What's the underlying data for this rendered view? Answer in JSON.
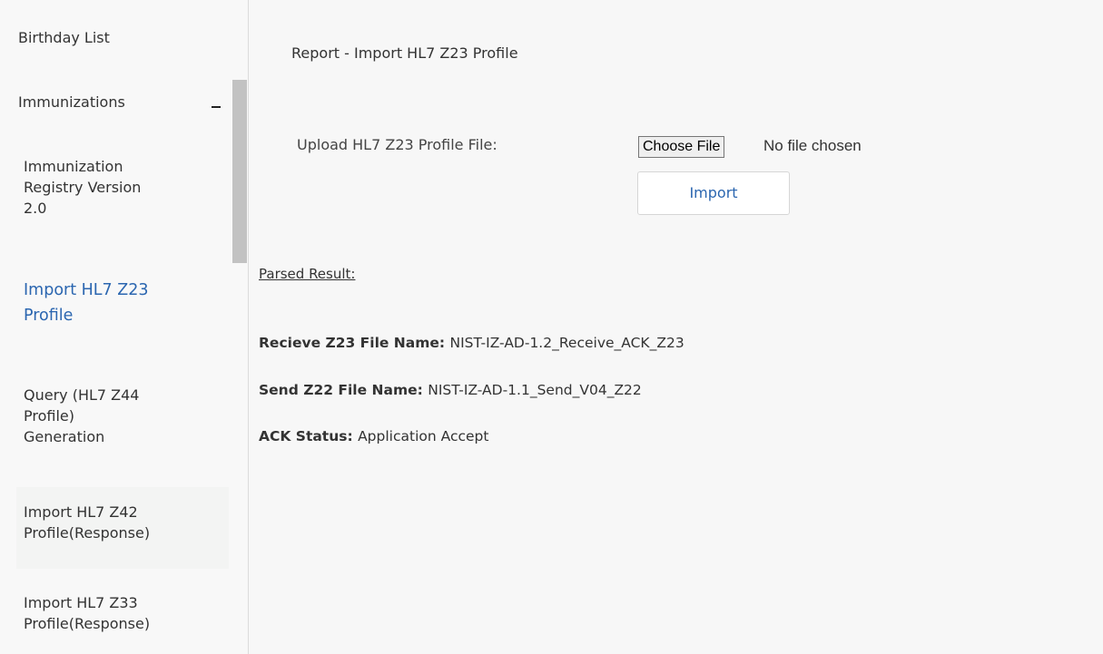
{
  "sidebar": {
    "items": [
      {
        "label": "Birthday List"
      },
      {
        "label": "Immunizations"
      },
      {
        "label": "Immunization\nRegistry Version\n2.0"
      },
      {
        "label": "Import HL7 Z23\nProfile"
      },
      {
        "label": "Query (HL7 Z44\nProfile)\nGeneration"
      },
      {
        "label": "Import HL7 Z42\nProfile(Response)"
      },
      {
        "label": "Import HL7 Z33\nProfile(Response)"
      }
    ],
    "collapse_symbol": "–",
    "active_color": "#2b66b0"
  },
  "main": {
    "title": "Report - Import HL7 Z23 Profile",
    "upload_label": "Upload HL7 Z23 Profile File:",
    "choose_file_label": "Choose File",
    "file_status": "No file chosen",
    "import_label": "Import",
    "parsed_label": "Parsed Result:",
    "results": [
      {
        "key": "Recieve Z23 File Name:",
        "value": "NIST-IZ-AD-1.2_Receive_ACK_Z23"
      },
      {
        "key": "Send Z22 File Name:",
        "value": "NIST-IZ-AD-1.1_Send_V04_Z22"
      },
      {
        "key": "ACK Status:",
        "value": "Application Accept"
      }
    ]
  }
}
